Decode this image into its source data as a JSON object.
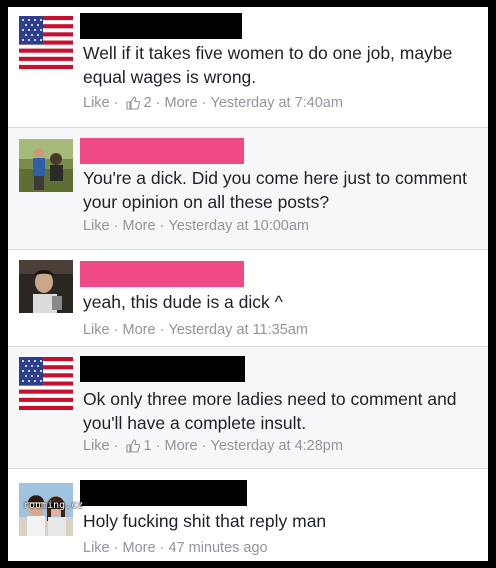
{
  "colors": {
    "text": "#1d2129",
    "meta": "#90949c",
    "redacted_black": "#000000",
    "redacted_pink": "#f04a86",
    "separator": "#d8dbe0"
  },
  "comments": [
    {
      "avatar": "us-flag-avatar",
      "name_redaction": "black",
      "text": "Well if it takes five women to do one job, maybe equal wages is wrong.",
      "like": "Like",
      "like_count": "2",
      "more": "More",
      "time": "Yesterday at 7:40am"
    },
    {
      "avatar": "user-photo-avatar",
      "name_redaction": "pink",
      "text": "You're a dick. Did you come here just to comment your opinion on all these posts?",
      "like": "Like",
      "more": "More",
      "time": "Yesterday at 10:00am"
    },
    {
      "avatar": "user-photo-avatar",
      "name_redaction": "pink",
      "text": "yeah, this dude is a dick ^",
      "like": "Like",
      "more": "More",
      "time": "Yesterday at 11:35am"
    },
    {
      "avatar": "us-flag-avatar",
      "name_redaction": "black",
      "text": "Ok only three more ladies need to comment and you'll have a complete insult.",
      "like": "Like",
      "like_count": "1",
      "more": "More",
      "time": "Yesterday at 4:28pm"
    },
    {
      "avatar": "couple-photo-avatar",
      "name_redaction": "black",
      "text": "Holy fucking shit that reply man",
      "like": "Like",
      "more": "More",
      "time": "47 minutes ago"
    }
  ],
  "separator": "·",
  "watermark": "rouming.cz"
}
